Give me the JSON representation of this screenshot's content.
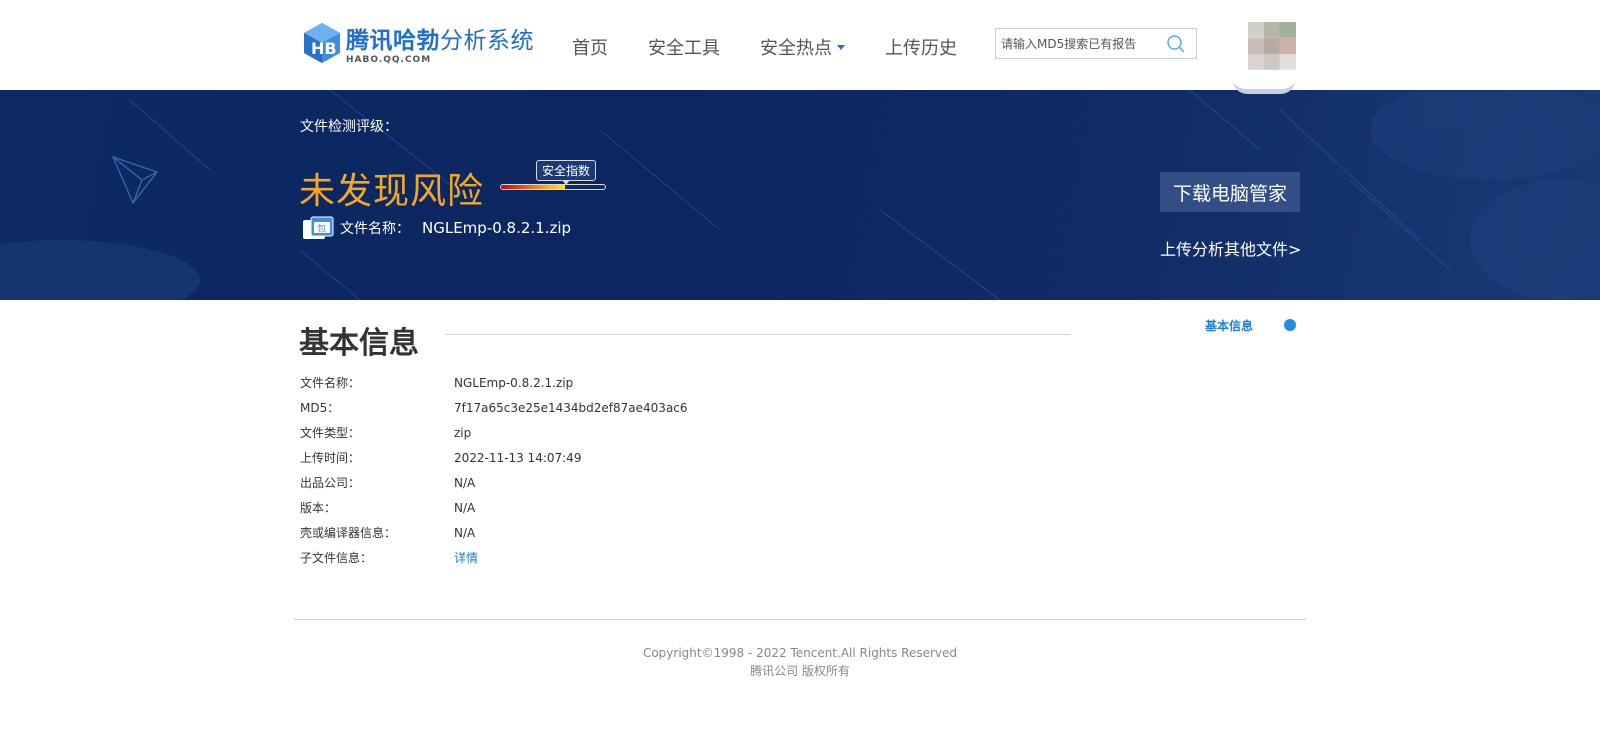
{
  "brand": {
    "title_bold": "腾讯哈勃",
    "title_rest": "分析系统",
    "subtitle": "HABO.QQ.COM"
  },
  "nav": {
    "items": [
      {
        "label": "首页"
      },
      {
        "label": "安全工具"
      },
      {
        "label": "安全热点"
      },
      {
        "label": "上传历史"
      }
    ]
  },
  "search": {
    "placeholder": "请输入MD5搜索已有报告"
  },
  "hero": {
    "rating_label": "文件检测评级：",
    "rating": "未发现风险",
    "gauge_tip": "安全指数",
    "gauge_level": 0.62,
    "file_label": "文件名称：",
    "file_name": "NGLEmp-0.8.2.1.zip",
    "zip_icon_text": "包",
    "download_label": "下载电脑管家",
    "upload_link": "上传分析其他文件>"
  },
  "basic_info": {
    "title": "基本信息",
    "side_nav_label": "基本信息",
    "rows": [
      {
        "key": "文件名称：",
        "value": "NGLEmp-0.8.2.1.zip"
      },
      {
        "key": "MD5：",
        "value": "7f17a65c3e25e1434bd2ef87ae403ac6"
      },
      {
        "key": "文件类型：",
        "value": "zip"
      },
      {
        "key": "上传时间：",
        "value": "2022-11-13 14:07:49"
      },
      {
        "key": "出品公司：",
        "value": "N/A"
      },
      {
        "key": "版本：",
        "value": "N/A"
      },
      {
        "key": "壳或编译器信息：",
        "value": "N/A"
      },
      {
        "key": "子文件信息：",
        "value": "详情"
      }
    ]
  },
  "footer": {
    "copyright": "Copyright©1998 - 2022 Tencent.All Rights Reserved",
    "copyright_cn": "腾讯公司 版权所有"
  },
  "colors": {
    "brand_blue": "#1f6fd1",
    "hero_bg": "#0d2a63",
    "risk_orange": "#f5a623",
    "link_blue": "#1f7fd6"
  }
}
